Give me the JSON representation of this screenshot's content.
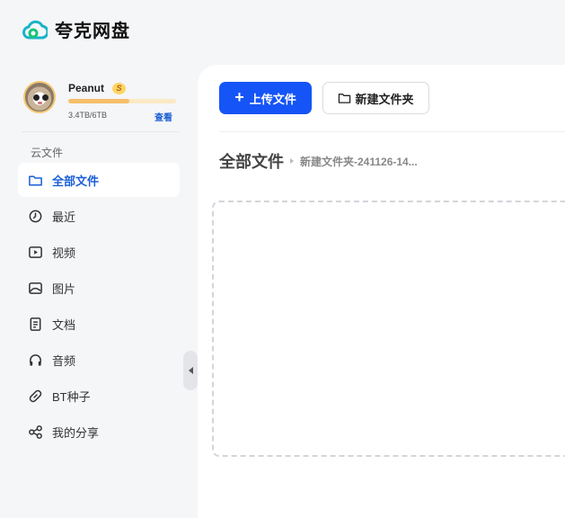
{
  "app": {
    "logo_text": "夸克网盘"
  },
  "user": {
    "name": "Peanut",
    "vip_badge": "S",
    "quota_text": "3.4TB/6TB",
    "quota_fraction": 0.567,
    "view_label": "查看"
  },
  "sidebar": {
    "section_title": "云文件",
    "items": [
      {
        "label": "全部文件",
        "icon": "folder-icon",
        "active": true
      },
      {
        "label": "最近",
        "icon": "clock-icon"
      },
      {
        "label": "视频",
        "icon": "video-icon"
      },
      {
        "label": "图片",
        "icon": "image-icon"
      },
      {
        "label": "文档",
        "icon": "document-icon"
      },
      {
        "label": "音频",
        "icon": "headphones-icon"
      },
      {
        "label": "BT种子",
        "icon": "bt-icon"
      },
      {
        "label": "我的分享",
        "icon": "share-icon"
      }
    ]
  },
  "toolbar": {
    "upload_label": "上传文件",
    "upload_plus": "+",
    "new_folder_label": "新建文件夹"
  },
  "breadcrumb": {
    "root": "全部文件",
    "current": "新建文件夹-241126-14..."
  },
  "colors": {
    "accent": "#1554f6",
    "link": "#1a5fd6"
  }
}
